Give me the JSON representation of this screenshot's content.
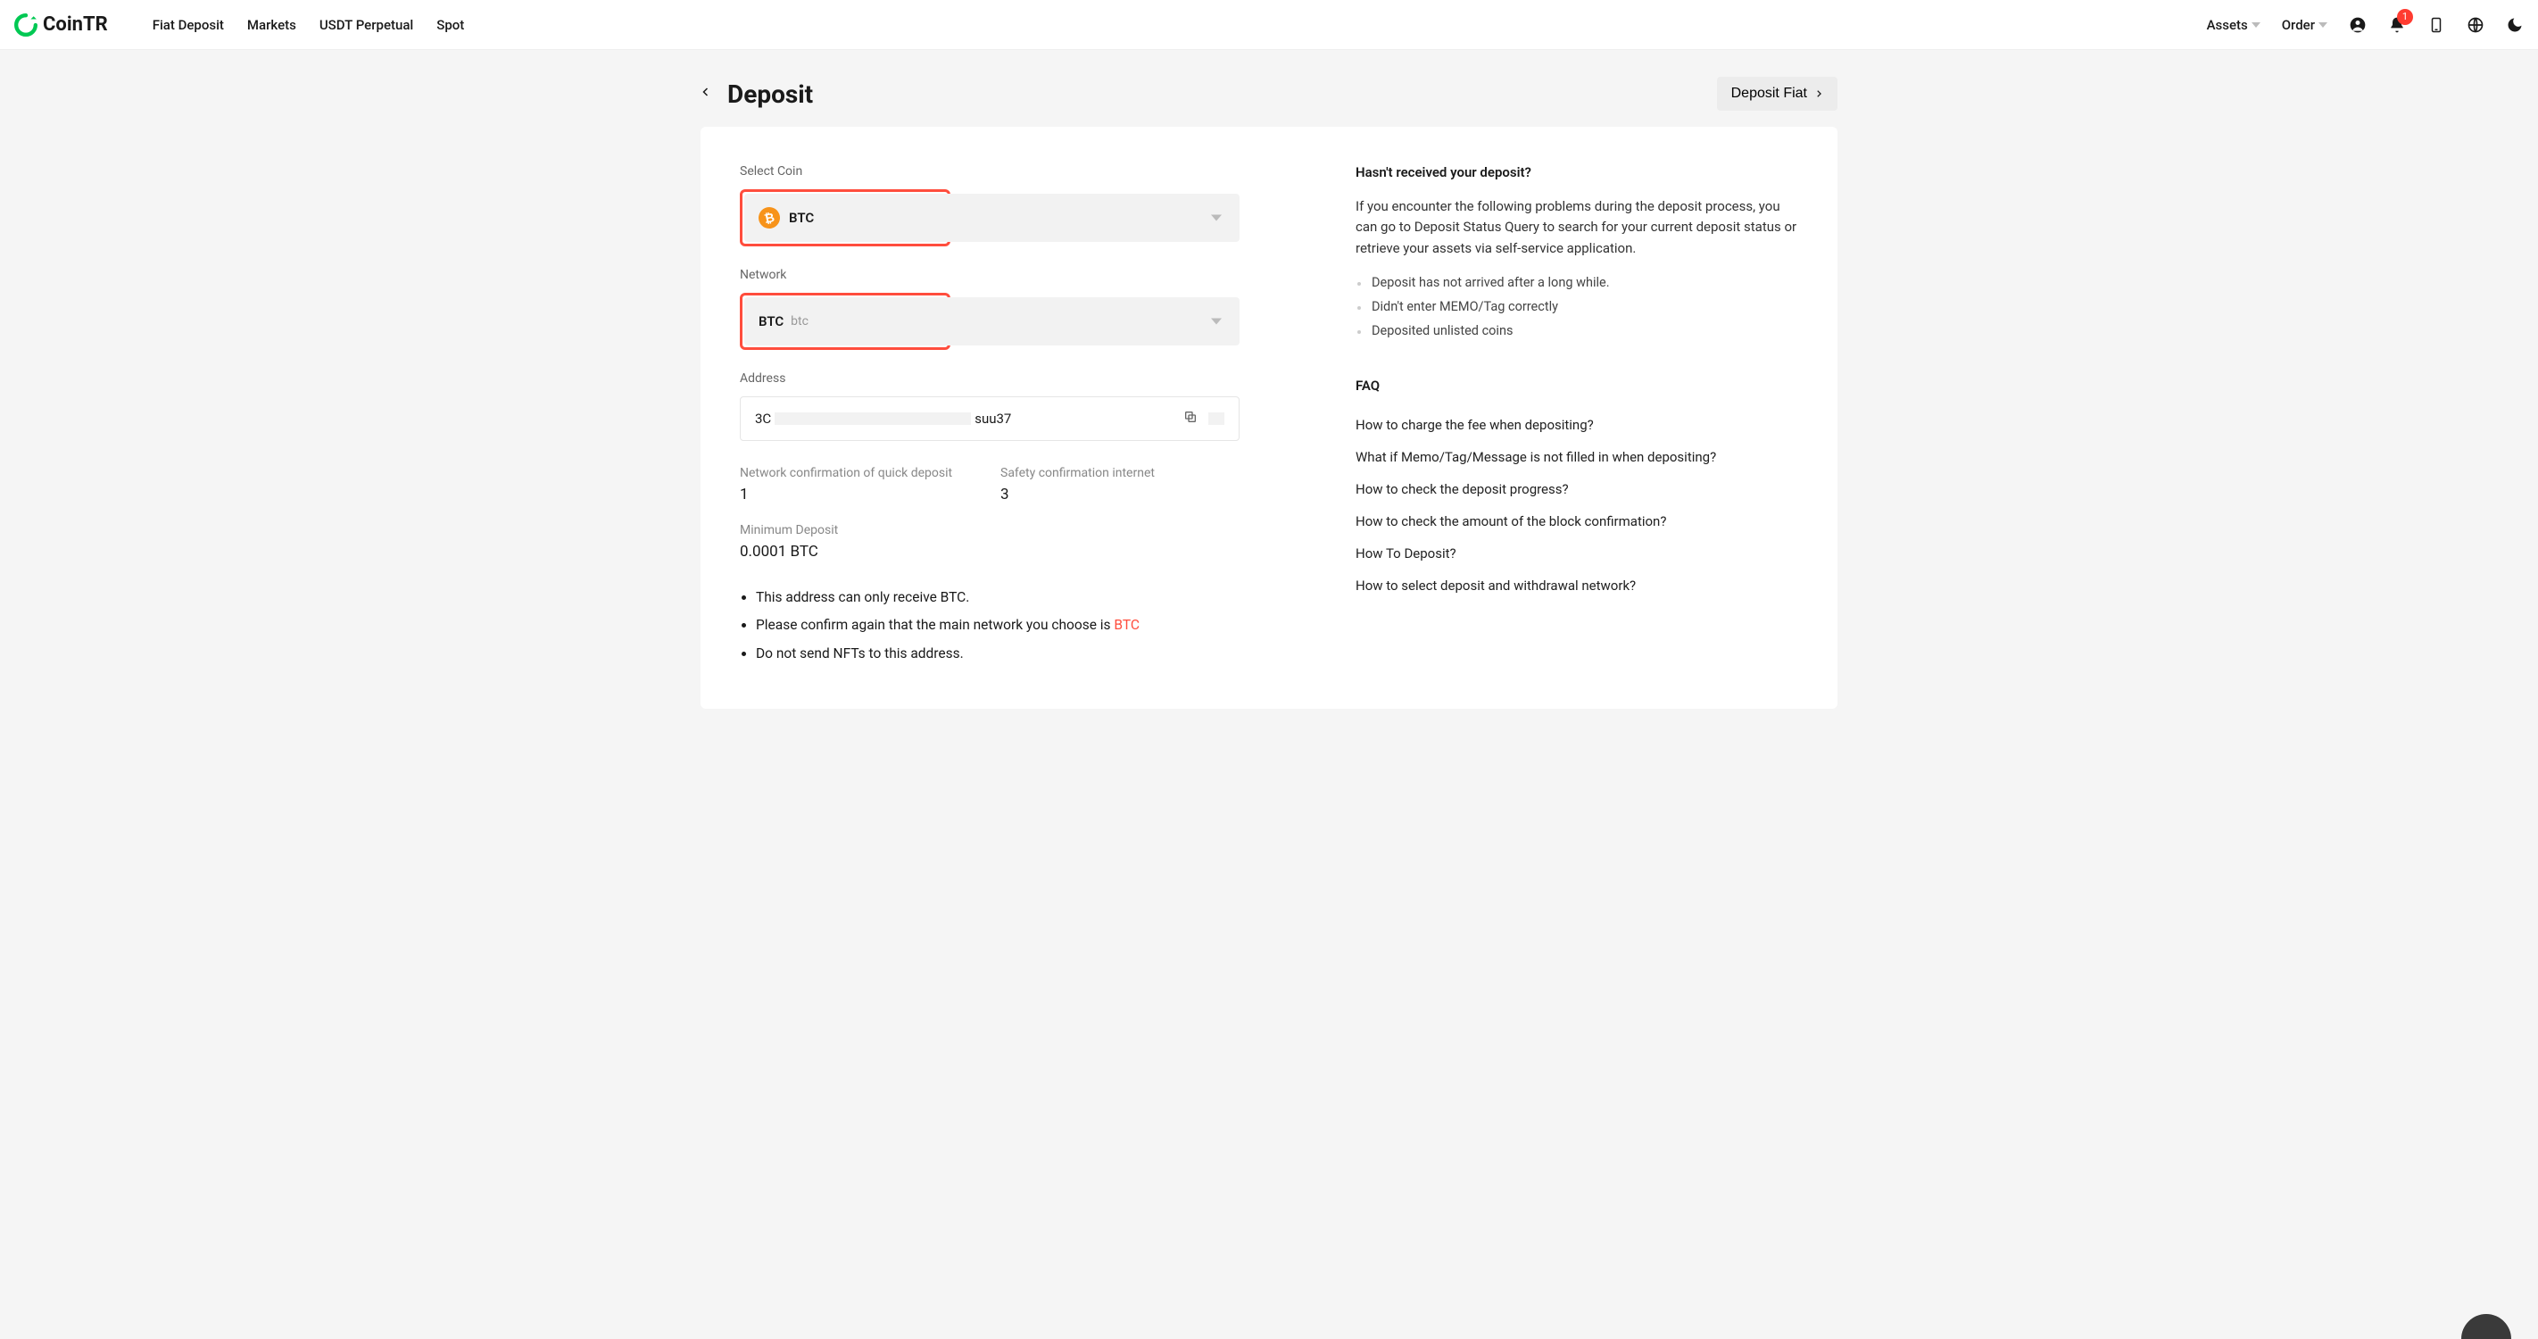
{
  "brand": {
    "name": "CoinTR"
  },
  "nav": {
    "items": [
      "Fiat Deposit",
      "Markets",
      "USDT Perpetual",
      "Spot"
    ]
  },
  "header": {
    "assets": "Assets",
    "order": "Order",
    "notification_count": "1"
  },
  "page": {
    "title": "Deposit",
    "deposit_fiat": "Deposit Fiat"
  },
  "form": {
    "select_coin_label": "Select Coin",
    "coin_symbol": "BTC",
    "network_label": "Network",
    "network_symbol": "BTC",
    "network_sub": "btc",
    "address_label": "Address",
    "address_prefix": "3C",
    "address_suffix": "suu37",
    "quick_confirm_label": "Network confirmation of quick deposit",
    "quick_confirm_value": "1",
    "safety_confirm_label": "Safety confirmation internet",
    "safety_confirm_value": "3",
    "min_deposit_label": "Minimum Deposit",
    "min_deposit_value": "0.0001 BTC"
  },
  "notes": {
    "n1": "This address can only receive BTC.",
    "n2_pre": "Please confirm again that the main network you choose is ",
    "n2_hl": "BTC",
    "n3": "Do not send NFTs to this address."
  },
  "help": {
    "heading": "Hasn't received your deposit?",
    "text": "If you encounter the following problems during the deposit process, you can go to Deposit Status Query to search for your current deposit status or retrieve your assets via self-service application.",
    "bullets": [
      "Deposit has not arrived after a long while.",
      "Didn't enter MEMO/Tag correctly",
      "Deposited unlisted coins"
    ]
  },
  "faq": {
    "heading": "FAQ",
    "items": [
      "How to charge the fee when depositing?",
      "What if Memo/Tag/Message is not filled in when depositing?",
      "How to check the deposit progress?",
      "How to check the amount of the block confirmation?",
      "How To Deposit?",
      "How to select deposit and withdrawal network?"
    ]
  }
}
